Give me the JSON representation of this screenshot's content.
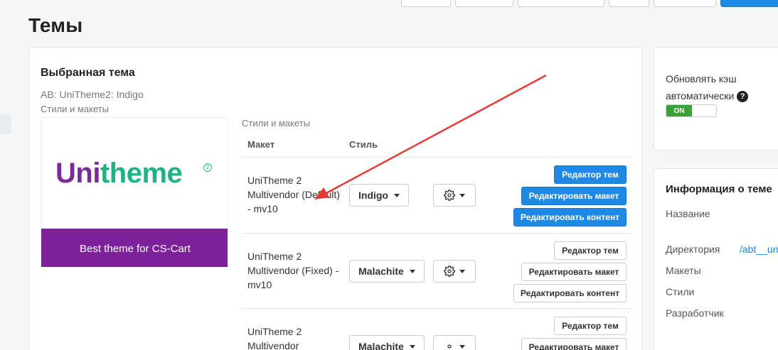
{
  "page": {
    "title": "Темы"
  },
  "selected_theme": {
    "heading": "Выбранная тема",
    "name": "AB: UniTheme2: Indigo",
    "subtitle": "Стили и макеты",
    "thumbnail": {
      "logo_part1": "Uni",
      "logo_part2": "theme",
      "logo_badge": "2",
      "banner": "Best theme for CS-Cart"
    }
  },
  "layouts_table": {
    "caption": "Стили и макеты",
    "columns": [
      "Макет",
      "Стиль"
    ],
    "rows": [
      {
        "layout": "UniTheme 2 Multivendor (Default) - mv10",
        "style": "Indigo",
        "actions": [
          "Редактор тем",
          "Редактировать макет",
          "Редактировать контент"
        ],
        "active": true
      },
      {
        "layout": "UniTheme 2 Multivendor (Fixed) - mv10",
        "style": "Malachite",
        "actions": [
          "Редактор тем",
          "Редактировать макет",
          "Редактировать контент"
        ],
        "active": false
      },
      {
        "layout": "UniTheme 2 Multivendor",
        "style": "Malachite",
        "actions": [
          "Редактор тем",
          "Редактировать макет"
        ],
        "active": false
      }
    ]
  },
  "sidebar": {
    "cache": {
      "label": "Обновлять кэш автоматически",
      "help_icon": "question-circle-icon",
      "toggle_state": "ON"
    },
    "info": {
      "title": "Информация о теме",
      "fields": [
        {
          "label": "Название",
          "value": ""
        },
        {
          "label": "Директория",
          "value": "/abt__uni"
        },
        {
          "label": "Макеты",
          "value": ""
        },
        {
          "label": "Стили",
          "value": ""
        },
        {
          "label": "Разработчик",
          "value": ""
        }
      ]
    }
  },
  "colors": {
    "primary": "#1e88e5",
    "toggle_on": "#3aa23a",
    "logo_purple": "#7b2a9a",
    "logo_green": "#1db384",
    "banner": "#7c2199",
    "annotation_arrow": "#e53935"
  }
}
